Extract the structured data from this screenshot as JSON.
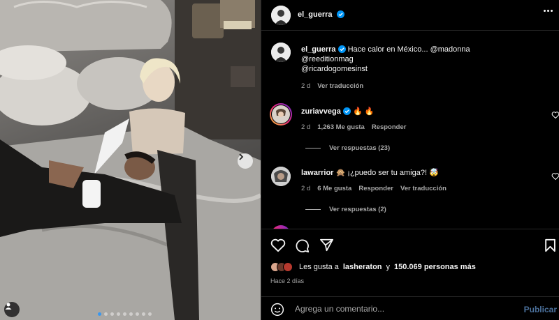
{
  "photo": {
    "carousel_dots": 9,
    "active_dot": 0,
    "next_icon": "chevron-right-icon",
    "tag_icon": "user-tag-icon"
  },
  "header": {
    "username": "el_guerra",
    "verified": true,
    "more_icon": "more-horizontal-icon"
  },
  "caption": {
    "username": "el_guerra",
    "line1": "Hace calor en México... @madonna",
    "line2": "@reeditionmag",
    "line3": "@ricardogomesinst",
    "time": "2 d",
    "translate": "Ver traducción"
  },
  "comments": [
    {
      "username": "zuriavvega",
      "verified": true,
      "text": "🔥 🔥",
      "time": "2 d",
      "likes": "1,263 Me gusta",
      "reply": "Responder",
      "translate": "",
      "replies": "Ver respuestas (23)"
    },
    {
      "username": "lawarrior",
      "verified": false,
      "text": "🙊 ¡¿puedo ser tu amiga?! 🤯",
      "time": "2 d",
      "likes": "6 Me gusta",
      "reply": "Responder",
      "translate": "Ver traducción",
      "replies": "Ver respuestas (2)"
    }
  ],
  "actions": {
    "like_icon": "heart-icon",
    "comment_icon": "comment-icon",
    "share_icon": "share-icon",
    "save_icon": "bookmark-icon"
  },
  "likes": {
    "prefix": "Les gusta a",
    "user": "lasheraton",
    "connector": "y",
    "count": "150.069 personas más"
  },
  "time": "Hace 2 días",
  "add_comment": {
    "placeholder": "Agrega un comentario...",
    "publish": "Publicar",
    "emoji_icon": "emoji-icon"
  },
  "colors": {
    "background": "#000000",
    "verified": "#0095f6",
    "publish": "#4a6f9a",
    "secondary_text": "#a8a8a8"
  }
}
